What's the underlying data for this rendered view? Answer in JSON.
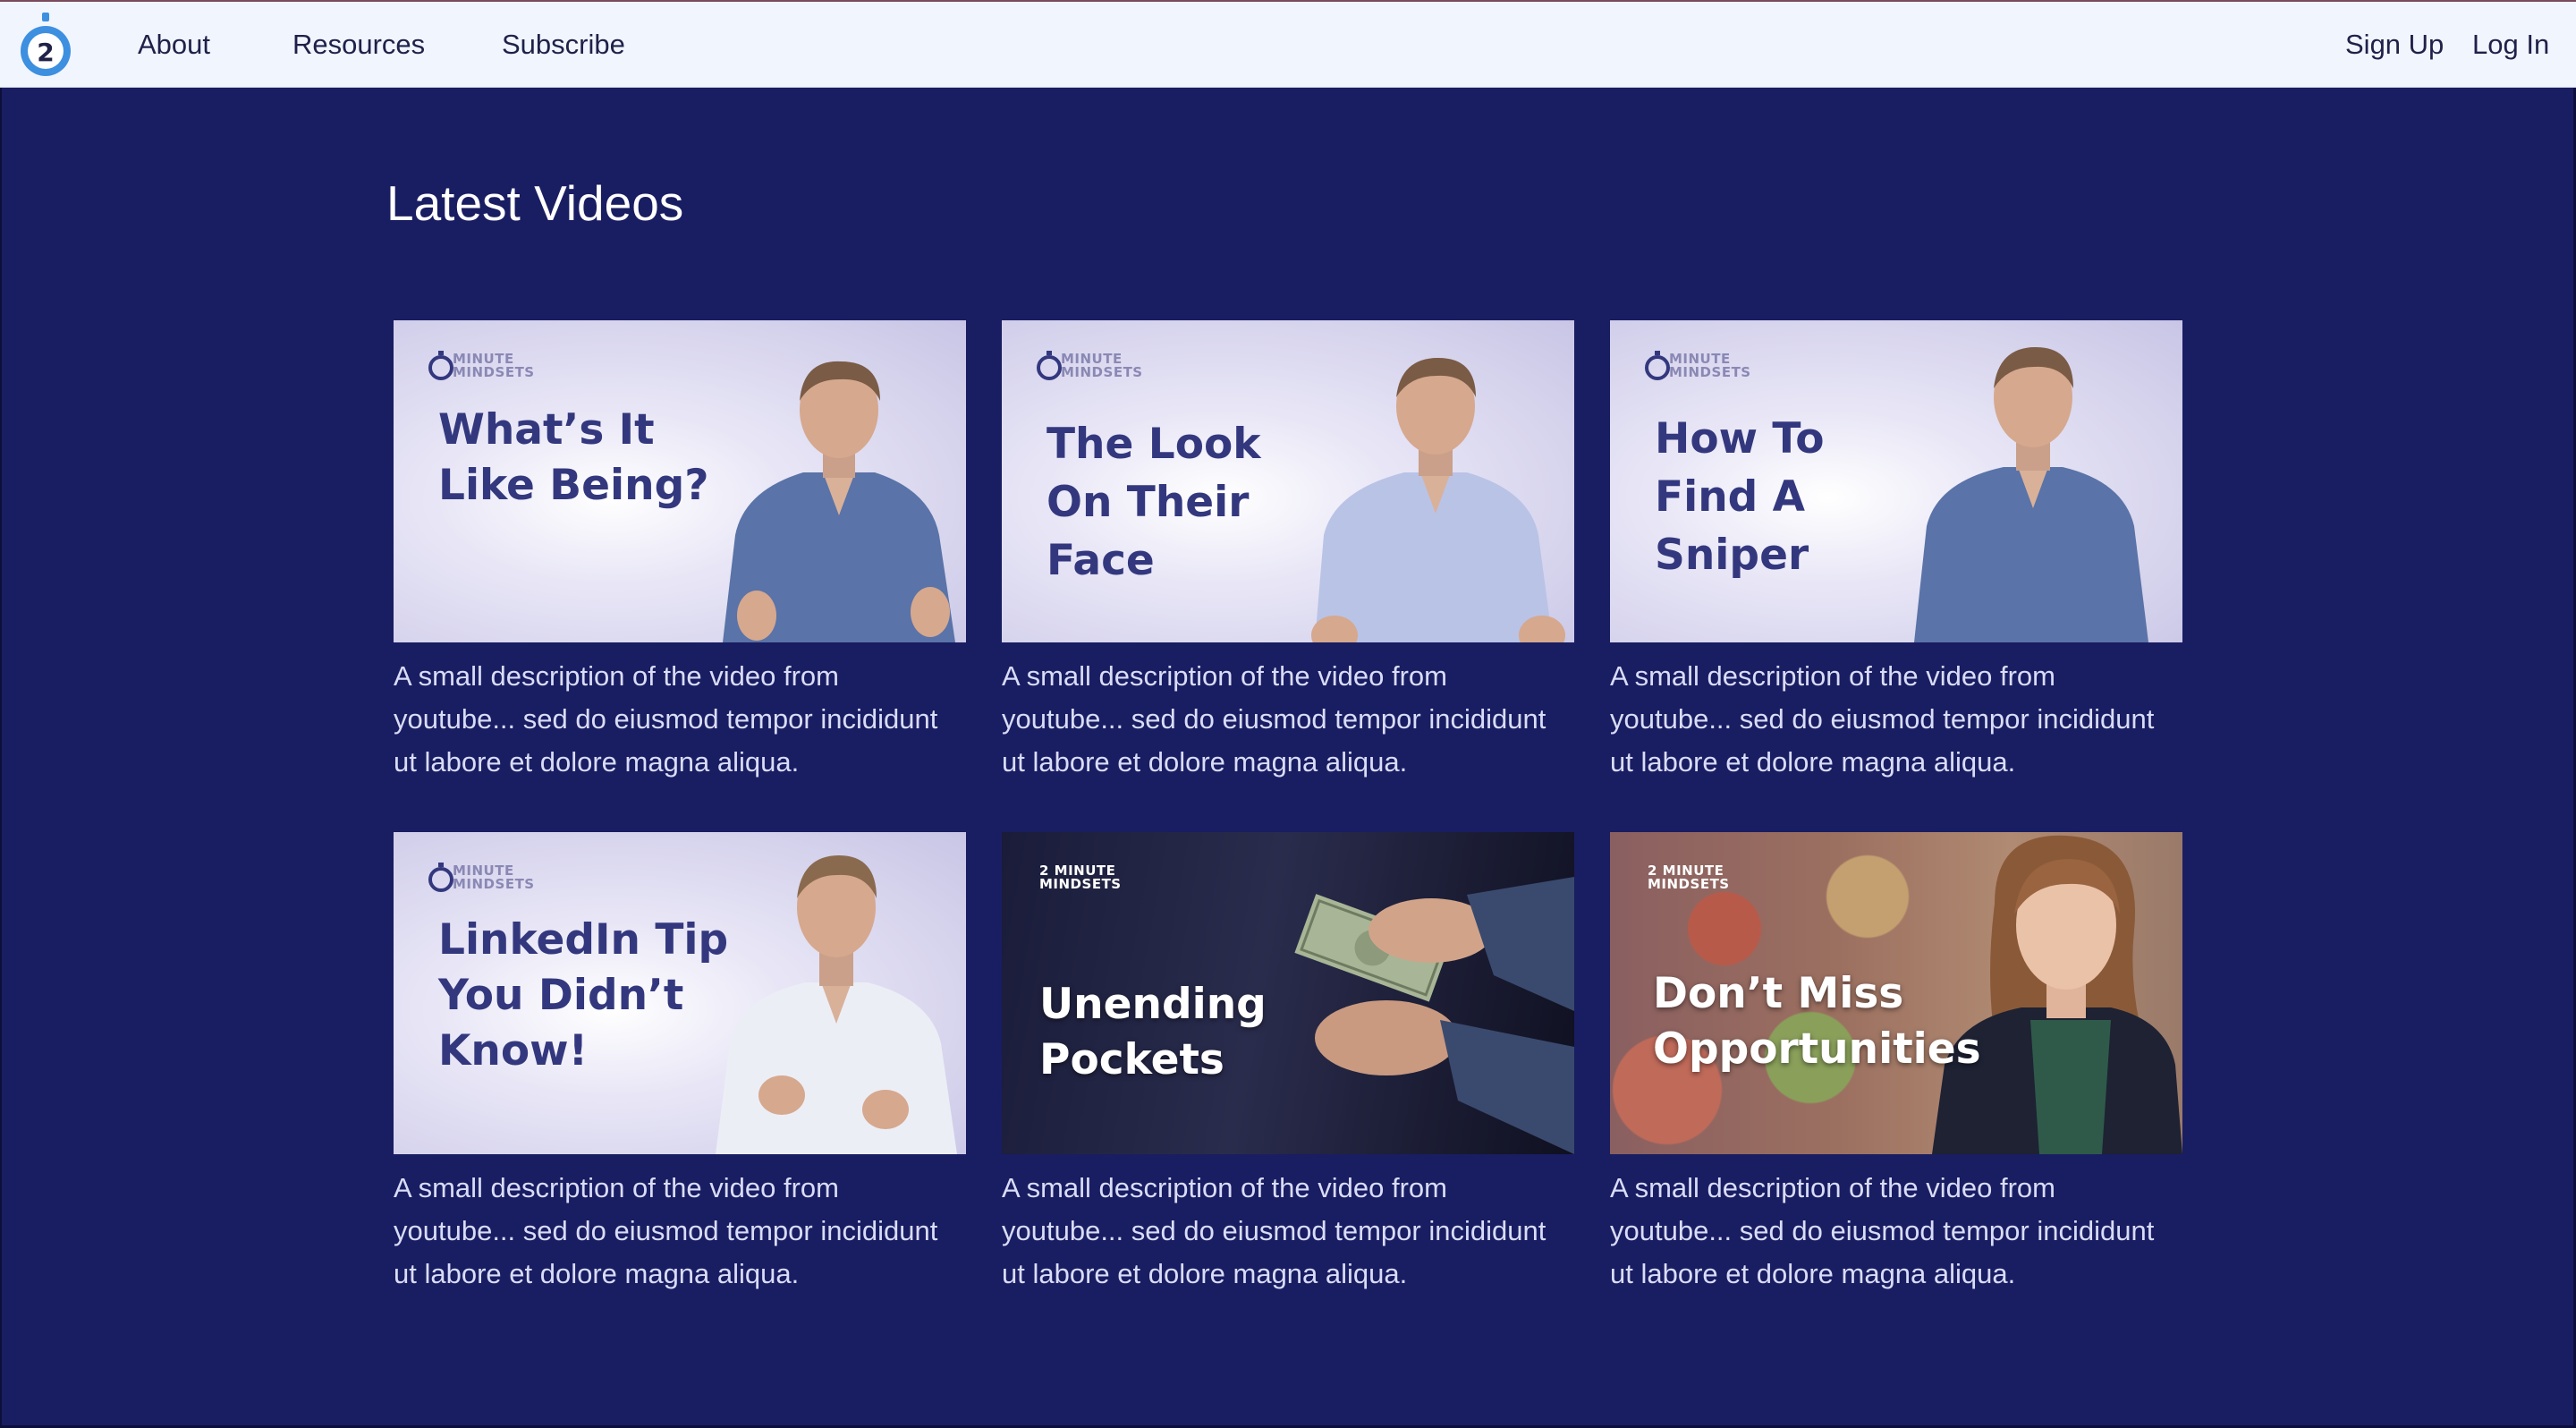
{
  "nav": {
    "left_links": [
      "About",
      "Resources",
      "Subscribe"
    ],
    "right_links": [
      "Sign Up",
      "Log In"
    ],
    "logo_digit": "2"
  },
  "main": {
    "section_title": "Latest Videos",
    "videos": [
      {
        "thumb_title": "What’s It\nLike Being?",
        "brand": "MINUTE\nMINDSETS",
        "description": "A small description of the video from youtube... sed do eiusmod tempor incididunt ut labore et dolore magna aliqua."
      },
      {
        "thumb_title": "The Look\nOn Their\nFace",
        "brand": "MINUTE\nMINDSETS",
        "description": "A small description of the video from youtube... sed do eiusmod tempor incididunt ut labore et dolore magna aliqua."
      },
      {
        "thumb_title": "How To\nFind A\nSniper",
        "brand": "MINUTE\nMINDSETS",
        "description": "A small description of the video from youtube... sed do eiusmod tempor incididunt ut labore et dolore magna aliqua."
      },
      {
        "thumb_title": "LinkedIn Tip\nYou Didn’t\nKnow!",
        "brand": "MINUTE\nMINDSETS",
        "description": "A small description of the video from youtube... sed do eiusmod tempor incididunt ut labore et dolore magna aliqua."
      },
      {
        "thumb_title": "Unending\nPockets",
        "brand": "2 MINUTE\nMINDSETS",
        "description": "A small description of the video from youtube... sed do eiusmod tempor incididunt ut labore et dolore magna aliqua."
      },
      {
        "thumb_title": "Don’t Miss\nOpportunities",
        "brand": "2 MINUTE\nMINDSETS",
        "description": "A small description of the video from youtube... sed do eiusmod tempor incididunt ut labore et dolore magna aliqua."
      }
    ]
  },
  "colors": {
    "page_background": "#191d62",
    "topbar_background": "#f1f5fd",
    "logo_blue": "#3d8fe0",
    "nav_text": "#1f2149",
    "thumb_title": "#33387e",
    "description_text": "#d9dcf6"
  },
  "icons": {
    "logo": "stopwatch-logo-icon"
  }
}
